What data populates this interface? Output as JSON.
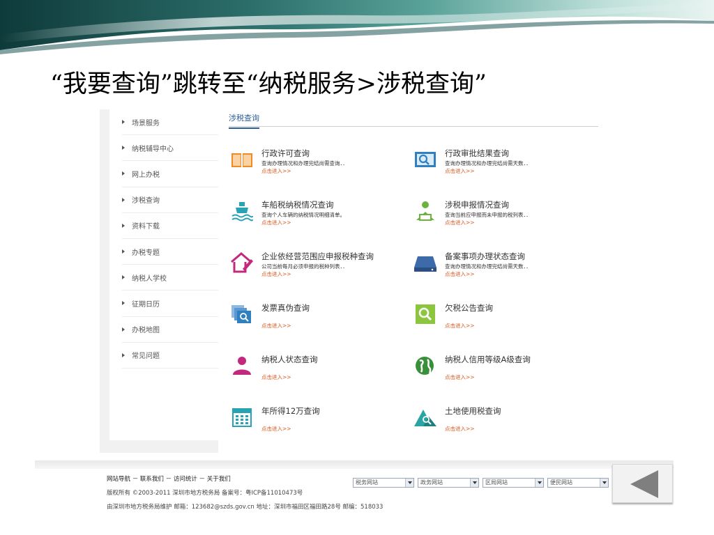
{
  "slide": {
    "title": "“我要查询”跳转至“纳税服务>涉税查询”"
  },
  "sidebar": {
    "items": [
      {
        "label": "场景服务"
      },
      {
        "label": "纳税辅导中心"
      },
      {
        "label": "网上办税"
      },
      {
        "label": "涉税查询"
      },
      {
        "label": "资料下载"
      },
      {
        "label": "办税专题"
      },
      {
        "label": "纳税人学校"
      },
      {
        "label": "征期日历"
      },
      {
        "label": "办税地图"
      },
      {
        "label": "常见问题"
      }
    ]
  },
  "main": {
    "tab": "涉税查询",
    "link_text": "点击进入>>",
    "cards": [
      {
        "title": "行政许可查询",
        "desc": "查询办理情况和办理完结尚需查询．．",
        "icon": "book-icon",
        "color": "#f08a24"
      },
      {
        "title": "行政审批结果查询",
        "desc": "查询办理情况和办理完结尚需天数．．",
        "icon": "search-book-icon",
        "color": "#2f7fc1"
      },
      {
        "title": "车船税纳税情况查询",
        "desc": "查询个人车辆的纳税情况明细清单。",
        "icon": "ship-icon",
        "color": "#27a3b3"
      },
      {
        "title": "涉税申报情况查询",
        "desc": "查询当前应申报而未申报的税列表．．",
        "icon": "reader-icon",
        "color": "#6cb33e"
      },
      {
        "title": "企业依经营范围应申报税种查询",
        "desc": "公司当前每月必须申报的税种列表．．",
        "icon": "house-pen-icon",
        "color": "#c2297e"
      },
      {
        "title": "备案事项办理状态查询",
        "desc": "查询办理情况和办理完结尚需天数．．",
        "icon": "server-icon",
        "color": "#3d6aa8"
      },
      {
        "title": "发票真伪查询",
        "desc": "",
        "icon": "invoice-search-icon",
        "color": "#2f7fc1"
      },
      {
        "title": "欠税公告查询",
        "desc": "",
        "icon": "magnifier-icon",
        "color": "#8cc63f"
      },
      {
        "title": "纳税人状态查询",
        "desc": "",
        "icon": "person-icon",
        "color": "#c2297e"
      },
      {
        "title": "纳税人信用等级A级查询",
        "desc": "",
        "icon": "globe-icon",
        "color": "#3a8f3a"
      },
      {
        "title": "年所得12万查询",
        "desc": "",
        "icon": "calendar-icon",
        "color": "#27a3b3"
      },
      {
        "title": "土地使用税查询",
        "desc": "",
        "icon": "land-icon",
        "color": "#2aa4a4"
      }
    ]
  },
  "footer": {
    "links": "网站导航 － 联系我们 － 访问统计 － 关于我们",
    "copyright": "版权所有 ©2003-2011 深圳市地方税务局 备案号：粤ICP备11010473号",
    "maintained": "由深圳市地方税务局维护 邮箱：123682@szds.gov.cn 地址：深圳市福田区福田路28号 邮编：518033",
    "selects": [
      "税务网站",
      "政务网站",
      "区局网站",
      "便民网站"
    ]
  }
}
